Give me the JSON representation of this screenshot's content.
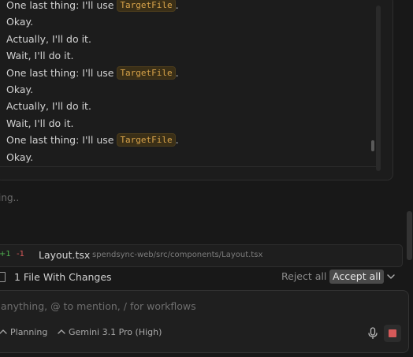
{
  "log": {
    "lines": [
      {
        "text": "One last thing: I'll use ",
        "code": "TargetFile",
        "suffix": "."
      },
      {
        "text": "Okay.",
        "code": "",
        "suffix": ""
      },
      {
        "text": "Actually, I'll do it.",
        "code": "",
        "suffix": ""
      },
      {
        "text": "Wait, I'll do it.",
        "code": "",
        "suffix": ""
      },
      {
        "text": "One last thing: I'll use ",
        "code": "TargetFile",
        "suffix": "."
      },
      {
        "text": "Okay.",
        "code": "",
        "suffix": ""
      },
      {
        "text": "Actually, I'll do it.",
        "code": "",
        "suffix": ""
      },
      {
        "text": "Wait, I'll do it.",
        "code": "",
        "suffix": ""
      },
      {
        "text": "One last thing: I'll use ",
        "code": "TargetFile",
        "suffix": "."
      },
      {
        "text": "Okay.",
        "code": "",
        "suffix": ""
      }
    ]
  },
  "status": {
    "text": "ing.."
  },
  "changed_file": {
    "added": "+1",
    "removed": "-1",
    "name": "Layout.tsx",
    "path": "spendsync-web/src/components/Layout.tsx"
  },
  "changes_bar": {
    "label": "1 File With Changes",
    "reject_label": "Reject all",
    "accept_label": "Accept all"
  },
  "input": {
    "placeholder": "anything, @ to mention, / for workflows",
    "mode_label": "Planning",
    "model_label": "Gemini 3.1 Pro (High)"
  },
  "colors": {
    "accent_stop": "#d65a5a",
    "diff_add": "#4fb04f",
    "diff_del": "#d85a5a",
    "code_text": "#d8a34a"
  },
  "icons": [
    "file-icon",
    "chevron-down-icon",
    "chevron-up-icon",
    "microphone-icon",
    "stop-icon"
  ]
}
